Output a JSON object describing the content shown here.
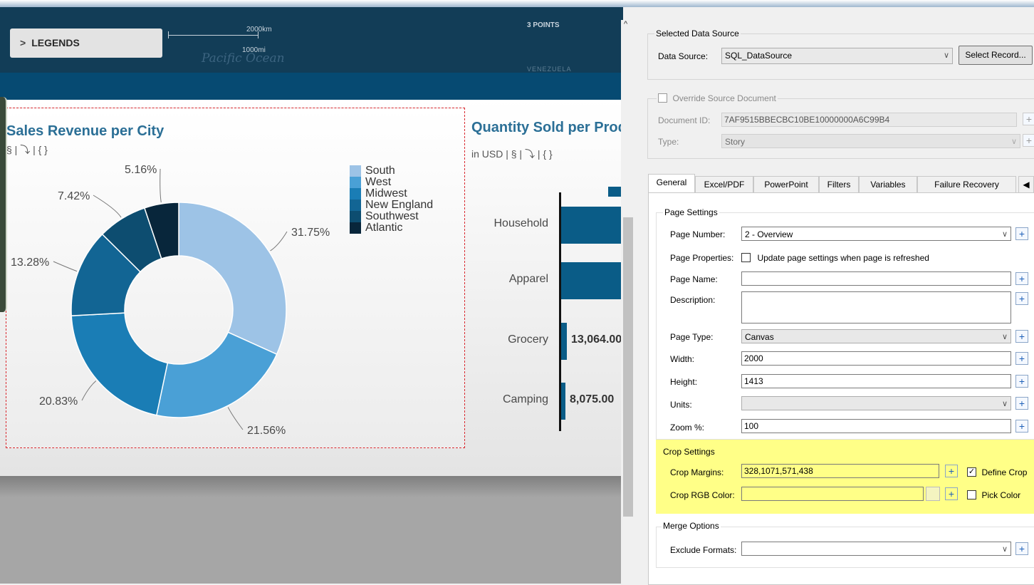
{
  "map": {
    "legend_button": "LEGENDS",
    "scale_top": "2000km",
    "scale_bottom": "1000mi",
    "ocean_label": "Pacific Ocean",
    "points_label": "3 POINTS",
    "country_label": "VENEZUELA"
  },
  "donut_chart": {
    "title": "Sales Revenue per City",
    "sub_icons": "§ | ⤵ | { }"
  },
  "bar_chart": {
    "title": "Quantity Sold per Produ",
    "subtitle": "in USD | § | ⤵ | { }"
  },
  "chart_data": [
    {
      "type": "pie",
      "title": "Sales Revenue per City",
      "categories": [
        "South",
        "West",
        "Midwest",
        "New England",
        "Southwest",
        "Atlantic"
      ],
      "values": [
        31.75,
        21.56,
        20.83,
        13.28,
        7.42,
        5.16
      ],
      "labels": [
        "31.75%",
        "21.56%",
        "20.83%",
        "13.28%",
        "7.42%",
        "5.16%"
      ],
      "colors": [
        "#9dc3e6",
        "#4aa0d6",
        "#1a7db5",
        "#126594",
        "#0d4d70",
        "#08263b"
      ],
      "legend_position": "right",
      "donut": true
    },
    {
      "type": "bar",
      "title": "Quantity Sold per Produ",
      "categories": [
        "Household",
        "Apparel",
        "Grocery",
        "Camping"
      ],
      "visible_value_labels": [
        "",
        "",
        "13,064.00",
        "8,075.00"
      ],
      "color": "#0a5c87",
      "orientation": "horizontal"
    }
  ],
  "dialog": {
    "selected_data_source": "Selected Data Source",
    "data_source_label": "Data Source:",
    "data_source_value": "SQL_DataSource",
    "select_record": "Select Record...",
    "override_label": "Override Source Document",
    "document_id_label": "Document ID:",
    "document_id_value": "7AF9515BBECBC10BE10000000A6C99B4",
    "type_label": "Type:",
    "type_value": "Story",
    "tabs": [
      "General",
      "Excel/PDF",
      "PowerPoint",
      "Filters",
      "Variables",
      "Failure Recovery"
    ],
    "page_settings": "Page Settings",
    "page_number_label": "Page Number:",
    "page_number_value": "2 - Overview",
    "page_properties_label": "Page Properties:",
    "page_properties_check": "Update page settings when page is refreshed",
    "page_name_label": "Page Name:",
    "page_name_value": "",
    "description_label": "Description:",
    "page_type_label": "Page Type:",
    "page_type_value": "Canvas",
    "width_label": "Width:",
    "width_value": "2000",
    "height_label": "Height:",
    "height_value": "1413",
    "units_label": "Units:",
    "units_value": "",
    "zoom_label": "Zoom %:",
    "zoom_value": "100",
    "crop_settings": "Crop Settings",
    "crop_margins_label": "Crop Margins:",
    "crop_margins_value": "328,1071,571,438",
    "define_crop": "Define Crop",
    "crop_rgb_label": "Crop RGB Color:",
    "crop_rgb_value": "",
    "pick_color": "Pick Color",
    "merge_options": "Merge Options",
    "exclude_formats_label": "Exclude Formats:",
    "exclude_formats_value": ""
  }
}
